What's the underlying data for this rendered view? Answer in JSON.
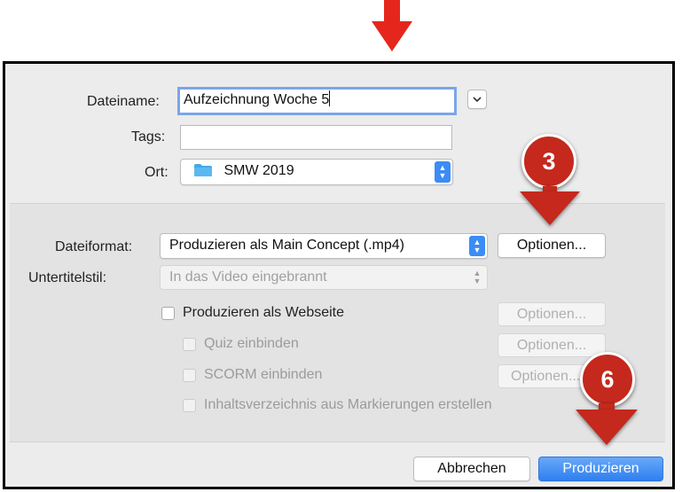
{
  "colors": {
    "annotation_red": "#e5261d",
    "marker_red": "#c5281c",
    "accent_blue": "#3b8cf5"
  },
  "annotations": {
    "top_arrow_icon": "down-arrow-icon",
    "marker_options": "3",
    "marker_produce": "6"
  },
  "save": {
    "filename_label": "Dateiname:",
    "filename_value": "Aufzeichnung Woche 5",
    "expand_icon": "chevron-down-icon",
    "tags_label": "Tags:",
    "tags_value": "",
    "location_label": "Ort:",
    "location_icon": "folder-icon",
    "location_value": "SMW 2019"
  },
  "format": {
    "file_format_label": "Dateiformat:",
    "file_format_value": "Produzieren als Main Concept (.mp4)",
    "options_button": "Optionen...",
    "subtitle_label": "Untertitelstil:",
    "subtitle_value": "In das Video eingebrannt"
  },
  "checkboxes": [
    {
      "label": "Produzieren als Webseite",
      "checked": false,
      "enabled": true,
      "options": "Optionen..."
    },
    {
      "label": "Quiz einbinden",
      "checked": false,
      "enabled": false,
      "options": "Optionen..."
    },
    {
      "label": "SCORM einbinden",
      "checked": false,
      "enabled": false,
      "options": "Optionen..."
    },
    {
      "label": "Inhaltsverzeichnis aus Markierungen erstellen",
      "checked": false,
      "enabled": false
    }
  ],
  "footer": {
    "cancel_button": "Abbrechen",
    "produce_button": "Produzieren"
  }
}
